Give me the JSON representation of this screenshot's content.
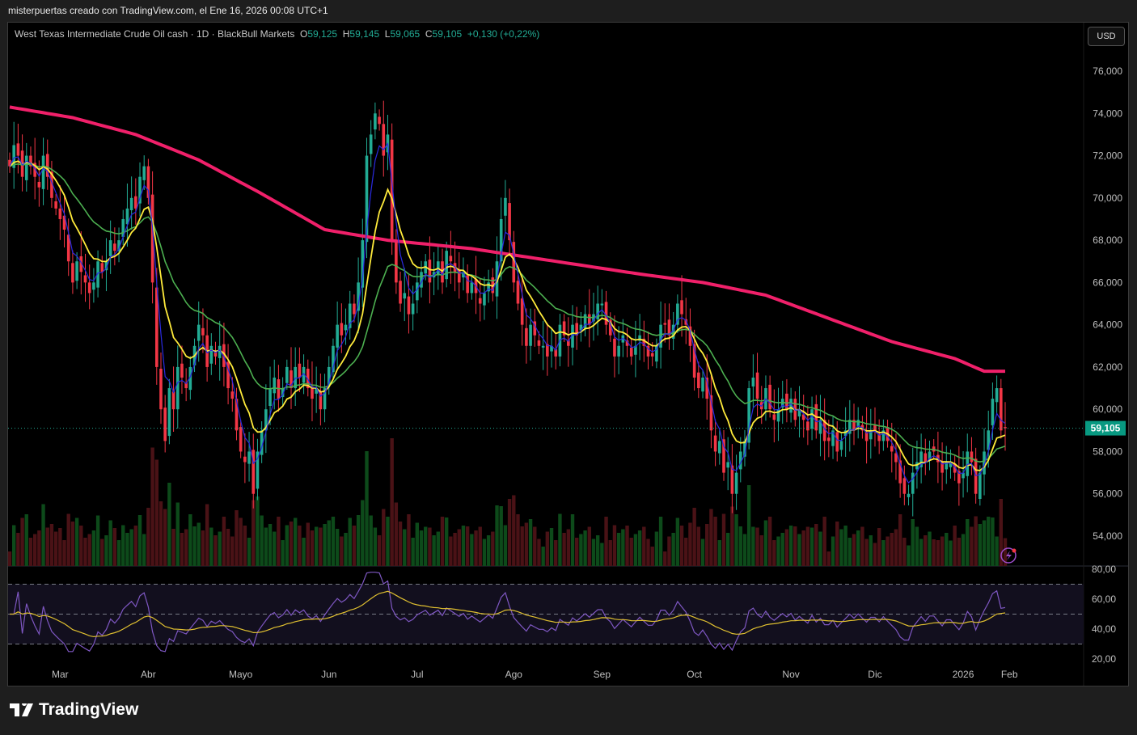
{
  "header": {
    "attribution": "misterpuertas creado con TradingView.com, el Ene 16, 2026 00:08 UTC+1"
  },
  "legend": {
    "symbol": "West Texas Intermediate Crude Oil cash · 1D · BlackBull Markets",
    "o_label": "O",
    "o": "59,125",
    "h_label": "H",
    "h": "59,145",
    "l_label": "L",
    "l": "59,065",
    "c_label": "C",
    "c": "59,105",
    "change": "+0,130 (+0,22%)"
  },
  "currency_button": "USD",
  "brand": "TradingView",
  "colors": {
    "up": "#22ab94",
    "down": "#f23645",
    "sma200": "#f0206a",
    "ma_green": "#4caf50",
    "ma_yellow": "#ffeb3b",
    "ma_blue": "#2a2ae0",
    "rsi": "#7e57c2",
    "rsi_ma": "#e0c030",
    "last_price_bg": "#089981"
  },
  "chart_data": {
    "type": "candlestick",
    "title": "West Texas Intermediate Crude Oil cash · 1D",
    "price_ticks": [
      "76,000",
      "74,000",
      "72,000",
      "70,000",
      "68,000",
      "66,000",
      "64,000",
      "62,000",
      "60,000",
      "58,000",
      "56,000",
      "54,000"
    ],
    "price_tick_values": [
      76,
      74,
      72,
      70,
      68,
      66,
      64,
      62,
      60,
      58,
      56,
      54
    ],
    "ylim": [
      53.5,
      77
    ],
    "last_price": "59,105",
    "last_price_value": 59.105,
    "month_labels": [
      "Mar",
      "Abr",
      "Mayo",
      "Jun",
      "Jul",
      "Ago",
      "Sep",
      "Oct",
      "Nov",
      "Dic",
      "2026",
      "Feb"
    ],
    "month_start_index": [
      12,
      33,
      55,
      76,
      97,
      120,
      141,
      163,
      186,
      206,
      227,
      238
    ],
    "closes": [
      71.5,
      72.5,
      72,
      71,
      72,
      71.5,
      71,
      70.5,
      72,
      71,
      70,
      69.5,
      69,
      68.5,
      67,
      66,
      67,
      66.5,
      66,
      65.5,
      66,
      67,
      66.5,
      67,
      68,
      67.5,
      68,
      69,
      69.5,
      70,
      69.5,
      71,
      71.5,
      70,
      66,
      62,
      60,
      58.5,
      61,
      60,
      62,
      61.5,
      61,
      62,
      63,
      64,
      63.5,
      62,
      63,
      62.5,
      63,
      62,
      61,
      60.5,
      59,
      58,
      57.5,
      58,
      56,
      58,
      59,
      60,
      61,
      61.5,
      60.5,
      61,
      62,
      61,
      62,
      61.5,
      62,
      61,
      60.5,
      61,
      60,
      61,
      62,
      63,
      64,
      63.5,
      64,
      65,
      64.5,
      66,
      68,
      72,
      73,
      74,
      73.5,
      72,
      73,
      68,
      66,
      65,
      65.5,
      64.5,
      65,
      66,
      66.5,
      67,
      66,
      66.5,
      67,
      66,
      67.5,
      67,
      66.5,
      66,
      66.5,
      65.5,
      66,
      65.5,
      65,
      65.5,
      66,
      65.5,
      67,
      69,
      70,
      68,
      66,
      65,
      64,
      63,
      64,
      63.5,
      63,
      63,
      62.5,
      63,
      62.5,
      64,
      63.5,
      63,
      64,
      63.5,
      64,
      64.5,
      64,
      64.5,
      65,
      65,
      64,
      63.5,
      62.5,
      63,
      63.5,
      63,
      62.5,
      63,
      63.5,
      63,
      62.5,
      62.5,
      63,
      64,
      64,
      63.5,
      64,
      65,
      64.5,
      64,
      63,
      61.5,
      61,
      61.5,
      60.5,
      59,
      58,
      58.5,
      57,
      57.5,
      56,
      57,
      58,
      58.5,
      61,
      61.5,
      60.5,
      60,
      61,
      60,
      59.5,
      60,
      60.5,
      60,
      60.5,
      59.5,
      60,
      59.5,
      59,
      60,
      59,
      59.5,
      58.5,
      58.5,
      59,
      58,
      58.5,
      59,
      59.5,
      59,
      59.5,
      59,
      58.5,
      59,
      59,
      58.5,
      59,
      58.5,
      58,
      57.5,
      56.5,
      56,
      56,
      57,
      57.5,
      58,
      57.5,
      58,
      58,
      57.5,
      57,
      57.5,
      57.5,
      57,
      56.5,
      57,
      58,
      57.5,
      56,
      57,
      58,
      59,
      60.5,
      61,
      59,
      59.105
    ],
    "sma200": [
      74.3,
      73.8,
      73,
      71.8,
      70.2,
      68.5,
      68,
      67.6,
      67,
      66.4,
      66,
      65.4,
      64.3,
      63.2,
      62.4,
      61.8,
      61.8
    ],
    "sma200_index": [
      0,
      15,
      30,
      45,
      60,
      75,
      90,
      110,
      130,
      150,
      165,
      180,
      195,
      210,
      225,
      232,
      237
    ],
    "rsi_ticks": [
      "80,00",
      "60,00",
      "40,00",
      "20,00"
    ],
    "rsi_tick_values": [
      80,
      60,
      40,
      20
    ],
    "rsi_bands": [
      70,
      50,
      30
    ]
  }
}
